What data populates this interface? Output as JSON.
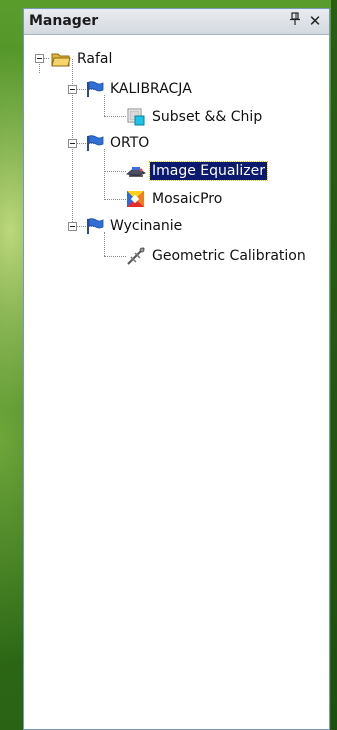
{
  "panel": {
    "title": "Manager",
    "pin_glyph": "❙",
    "close_glyph": "✕"
  },
  "tree": {
    "root": {
      "label": "Rafal",
      "icon": "folder-open-icon"
    },
    "groups": [
      {
        "label": "KALIBRACJA",
        "icon": "flag-icon",
        "children": [
          {
            "label": "Subset && Chip",
            "icon": "subset-chip-icon"
          }
        ]
      },
      {
        "label": "ORTO",
        "icon": "flag-icon",
        "children": [
          {
            "label": "Image Equalizer",
            "icon": "equalizer-icon",
            "selected": true
          },
          {
            "label": "MosaicPro",
            "icon": "mosaic-icon"
          }
        ]
      },
      {
        "label": "Wycinanie",
        "icon": "flag-icon",
        "children": [
          {
            "label": "Geometric Calibration",
            "icon": "calibration-icon"
          }
        ]
      }
    ]
  },
  "colors": {
    "selection_bg": "#0b1a6e",
    "selection_focus": "#e6c200",
    "desktop": "#3f8220"
  }
}
